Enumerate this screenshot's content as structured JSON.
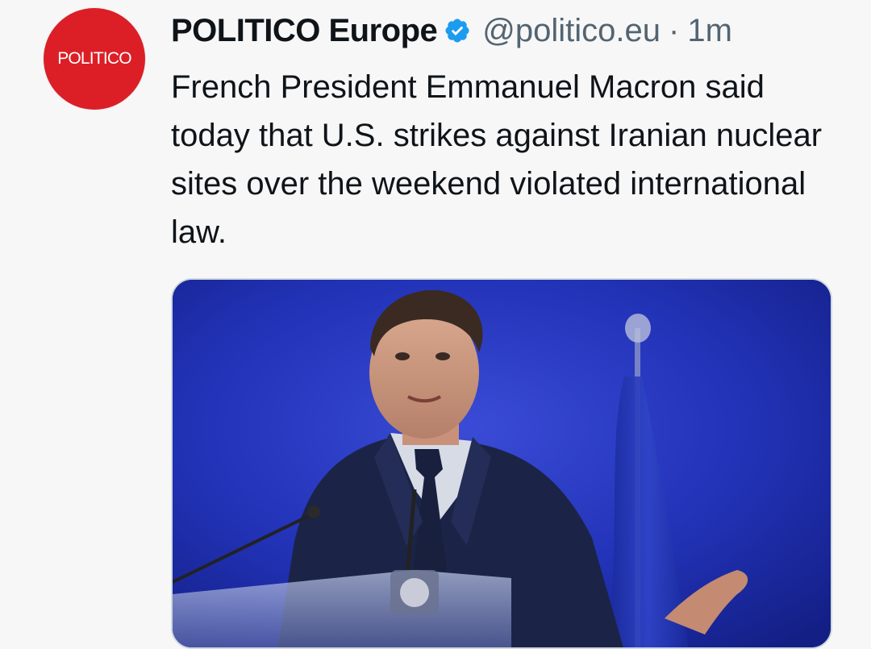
{
  "post": {
    "avatar": {
      "label": "POLITICO",
      "color": "#dc1f26"
    },
    "author": {
      "display_name": "POLITICO Europe",
      "verified": true,
      "verified_icon": "verified-badge-icon",
      "handle": "@politico.eu",
      "separator": "·",
      "timestamp": "1m"
    },
    "text": "French President Emmanuel Macron said today that U.S. strikes against Iranian nuclear sites over the weekend violated international law.",
    "media": {
      "type": "photo",
      "background_color": "#1f2fb0"
    }
  },
  "colors": {
    "text_primary": "#0f1419",
    "text_secondary": "#536471",
    "verified_blue": "#1d9bf0",
    "page_background": "#f7f7f7"
  }
}
